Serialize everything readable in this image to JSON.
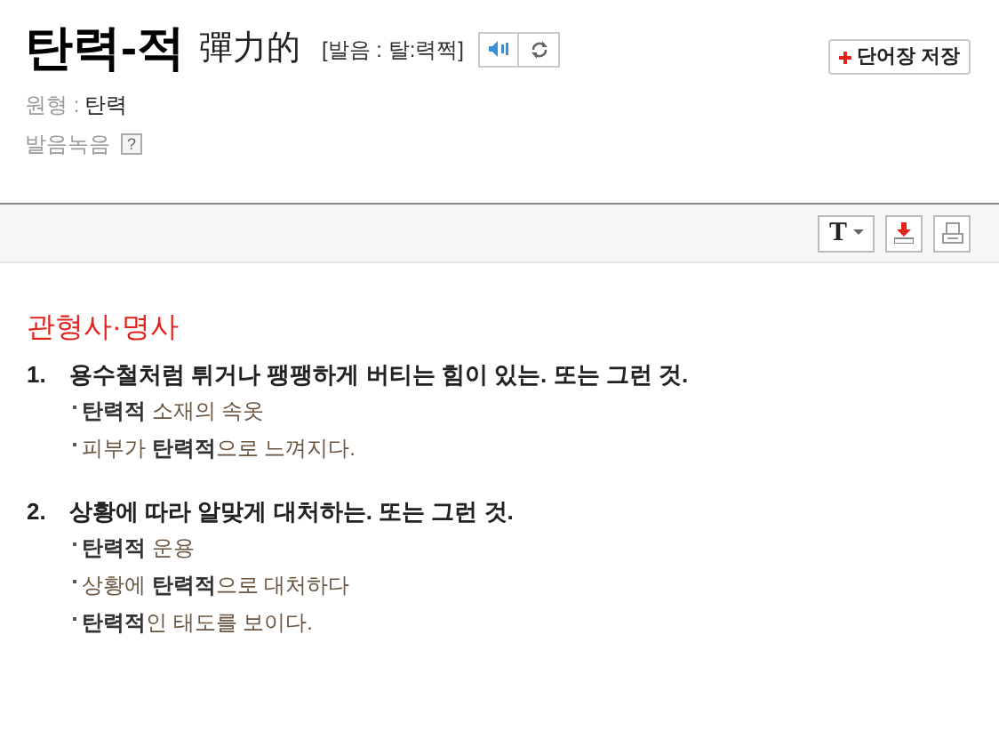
{
  "headword": "탄력-적",
  "hanja": "彈力的",
  "pronunciation": "[발음 : 탈:력쩍]",
  "save_button": "단어장 저장",
  "base_form": {
    "label": "원형 :",
    "value": "탄력"
  },
  "recording": {
    "label": "발음녹음",
    "help": "?"
  },
  "toolbar": {
    "font_button": "T"
  },
  "part_of_speech": "관형사·명사",
  "senses": [
    {
      "number": "1.",
      "definition": "용수철처럼 튀거나 팽팽하게 버티는 힘이 있는. 또는 그런 것.",
      "examples": [
        "**탄력적** 소재의 속옷",
        "피부가 **탄력적**으로 느껴지다."
      ]
    },
    {
      "number": "2.",
      "definition": "상황에 따라 알맞게 대처하는. 또는 그런 것.",
      "examples": [
        "**탄력적** 운용",
        "상황에 **탄력적**으로 대처하다",
        "**탄력적**인 태도를 보이다."
      ]
    }
  ]
}
